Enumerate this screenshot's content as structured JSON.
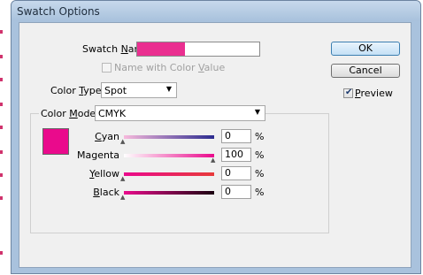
{
  "dialog": {
    "title": "Swatch Options"
  },
  "swatch_name": {
    "label_pre": "Swatch ",
    "label_hotkey": "N",
    "label_post": "ame:",
    "swatch_color": "#ea2f90"
  },
  "name_with_color_value": {
    "label_pre": "Name with Color ",
    "label_hotkey": "V",
    "label_post": "alue",
    "checked": false,
    "enabled": false
  },
  "color_type": {
    "label_pre": "Color ",
    "label_hotkey": "T",
    "label_post": "ype:",
    "value": "Spot"
  },
  "color_mode": {
    "label_pre": "Color ",
    "label_hotkey": "M",
    "label_post": "ode:",
    "value": "CMYK"
  },
  "buttons": {
    "ok": "OK",
    "cancel": "Cancel"
  },
  "preview": {
    "label_hotkey": "P",
    "label_post": "review",
    "checked": true
  },
  "color_preview": {
    "color": "#ea0a8c"
  },
  "sliders": [
    {
      "name": "cyan",
      "label_hotkey": "C",
      "label_post": "yan",
      "value": "0",
      "percent": "%",
      "gradient": [
        "#f7b9dc",
        "#2b2b8f"
      ]
    },
    {
      "name": "magenta",
      "label_hotkey": "",
      "label_post": "Magenta",
      "value": "100",
      "percent": "%",
      "gradient": [
        "#ffffff",
        "#ea0a8c"
      ]
    },
    {
      "name": "yellow",
      "label_hotkey": "Y",
      "label_post": "ellow",
      "value": "0",
      "percent": "%",
      "gradient": [
        "#ea0a8c",
        "#e83a3a"
      ]
    },
    {
      "name": "black",
      "label_hotkey": "B",
      "label_post": "lack",
      "value": "0",
      "percent": "%",
      "gradient": [
        "#ea0a8c",
        "#1a0010"
      ]
    }
  ]
}
